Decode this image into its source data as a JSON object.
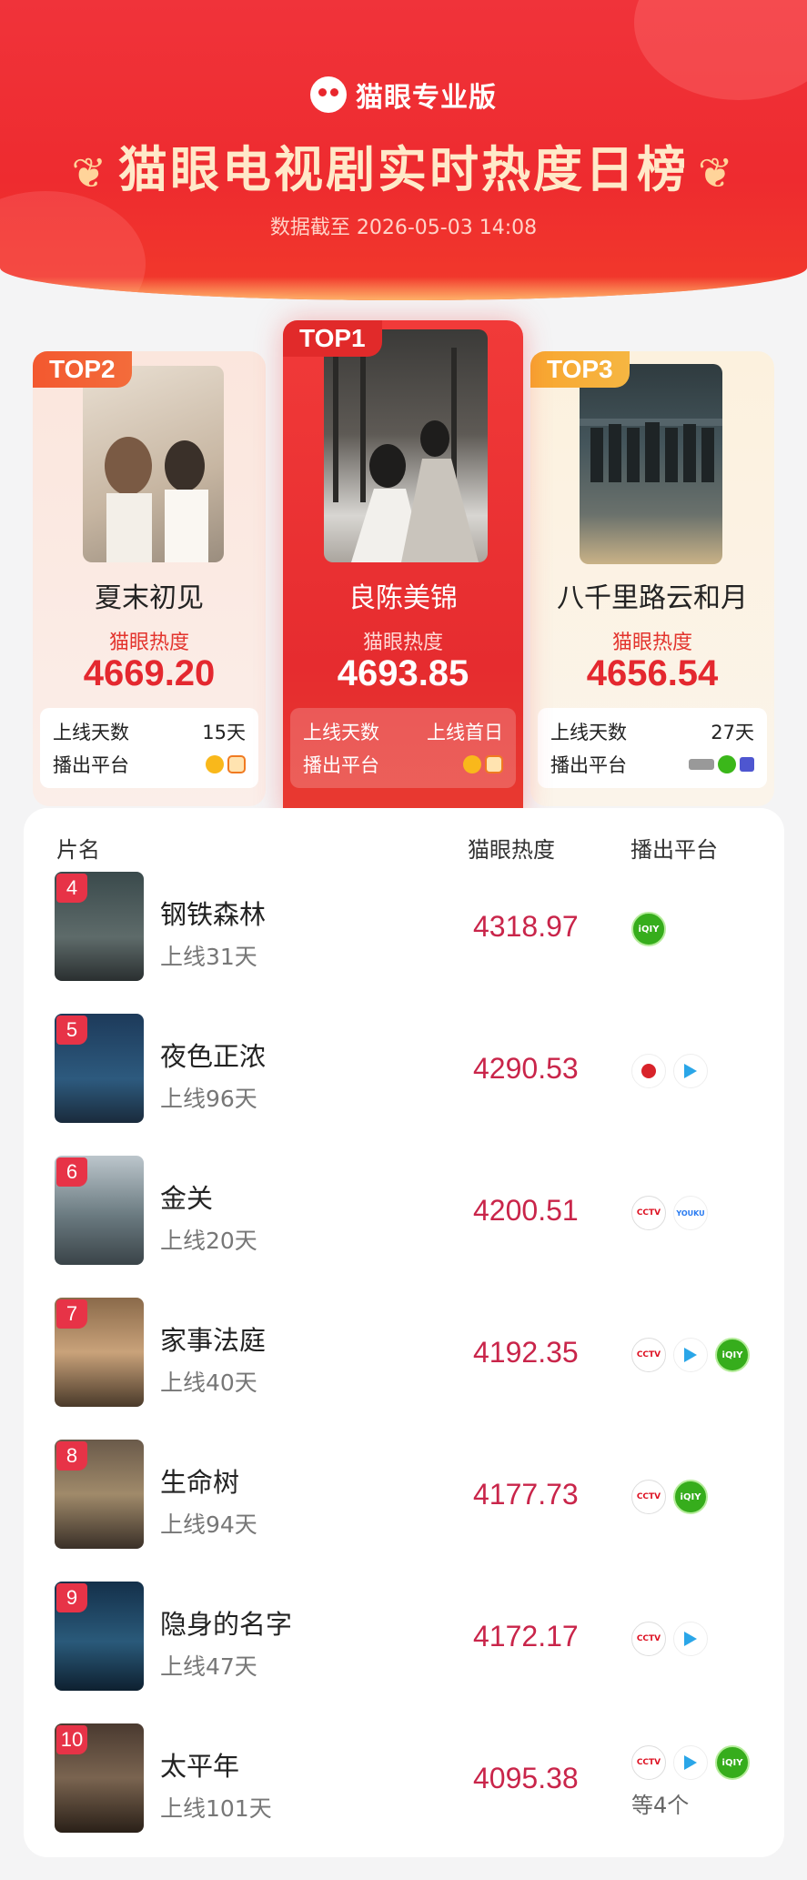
{
  "header": {
    "brand": "猫眼专业版",
    "title": "猫眼电视剧实时热度日榜",
    "subtitle": "数据截至 2026-05-03 14:08"
  },
  "labels": {
    "heat": "猫眼热度",
    "days": "上线天数",
    "platform": "播出平台"
  },
  "top": {
    "t1": {
      "badge": "TOP1",
      "name": "良陈美锦",
      "heat": "4693.85",
      "days": "上线首日",
      "poster_text": "良陈美锦"
    },
    "t2": {
      "badge": "TOP2",
      "name": "夏末初见",
      "heat": "4669.20",
      "days": "15天",
      "poster_text": "夏末初见"
    },
    "t3": {
      "badge": "TOP3",
      "name": "八千里路云和月",
      "heat": "4656.54",
      "days": "27天",
      "poster_text": "八千里路云和月"
    }
  },
  "list_header": {
    "name": "片名",
    "heat": "猫眼热度",
    "platform": "播出平台"
  },
  "rows": [
    {
      "rank": "4",
      "name": "钢铁森林",
      "days": "上线31天",
      "heat": "4318.97"
    },
    {
      "rank": "5",
      "name": "夜色正浓",
      "days": "上线96天",
      "heat": "4290.53"
    },
    {
      "rank": "6",
      "name": "金关",
      "days": "上线20天",
      "heat": "4200.51"
    },
    {
      "rank": "7",
      "name": "家事法庭",
      "days": "上线40天",
      "heat": "4192.35"
    },
    {
      "rank": "8",
      "name": "生命树",
      "days": "上线94天",
      "heat": "4177.73"
    },
    {
      "rank": "9",
      "name": "隐身的名字",
      "days": "上线47天",
      "heat": "4172.17"
    },
    {
      "rank": "10",
      "name": "太平年",
      "days": "上线101天",
      "heat": "4095.38",
      "more": "等4个"
    }
  ],
  "icon_text": {
    "cctv": "CCTV",
    "iqiyi": "iQIY",
    "youku": "YOUKU"
  },
  "colors": {
    "accent": "#e4282f",
    "heat_red": "#c9254a",
    "iqiyi_green": "#36ad1c"
  }
}
